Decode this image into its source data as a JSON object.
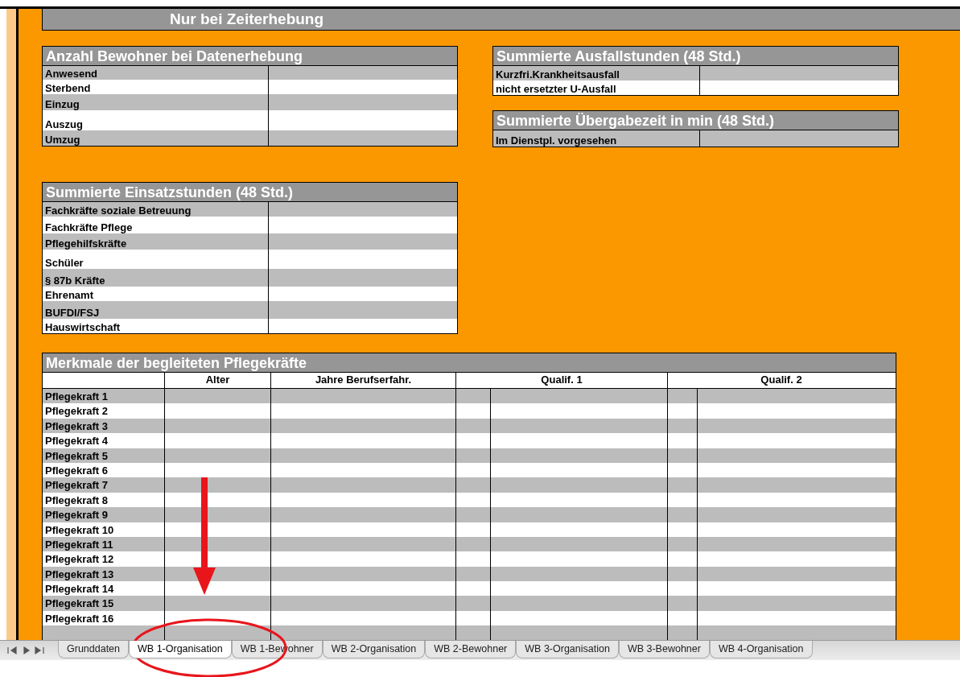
{
  "title": "Nur bei Zeiterhebung",
  "residents": {
    "title": "Anzahl Bewohner bei Datenerhebung",
    "rows": [
      "Anwesend",
      "Sterbend",
      "Einzug",
      "Auszug",
      "Umzug"
    ]
  },
  "absence_hours": {
    "title": "Summierte Ausfallstunden (48 Std.)",
    "rows": [
      "Kurzfri.Krankheitsausfall",
      "nicht ersetzter U-Ausfall"
    ]
  },
  "handover_time": {
    "title": "Summierte Übergabezeit in min (48 Std.)",
    "rows": [
      "Im Dienstpl. vorgesehen"
    ]
  },
  "deployment_hours": {
    "title": "Summierte Einsatzstunden (48 Std.)",
    "rows": [
      "Fachkräfte soziale Betreuung",
      "Fachkräfte Pflege",
      "Pflegehilfskräfte",
      "Schüler",
      "§ 87b Kräfte",
      "Ehrenamt",
      "BUFDI/FSJ",
      "Hauswirtschaft"
    ]
  },
  "staff_table": {
    "title": "Merkmale der begleiteten Pflegekräfte",
    "columns": [
      "Alter",
      "Jahre Berufserfahr.",
      "Qualif. 1",
      "Qualif. 2"
    ],
    "rows": [
      "Pflegekraft 1",
      "Pflegekraft 2",
      "Pflegekraft 3",
      "Pflegekraft 4",
      "Pflegekraft 5",
      "Pflegekraft 6",
      "Pflegekraft 7",
      "Pflegekraft 8",
      "Pflegekraft 9",
      "Pflegekraft 10",
      "Pflegekraft 11",
      "Pflegekraft 12",
      "Pflegekraft 13",
      "Pflegekraft 14",
      "Pflegekraft 15",
      "Pflegekraft 16"
    ]
  },
  "sheet_tabs": [
    {
      "label": "Grunddaten",
      "selected": false
    },
    {
      "label": "WB 1-Organisation",
      "selected": true
    },
    {
      "label": "WB 1-Bewohner",
      "selected": false
    },
    {
      "label": "WB 2-Organisation",
      "selected": false
    },
    {
      "label": "WB 2-Bewohner",
      "selected": false
    },
    {
      "label": "WB 3-Organisation",
      "selected": false
    },
    {
      "label": "WB 3-Bewohner",
      "selected": false
    },
    {
      "label": "WB 4-Organisation",
      "selected": false
    }
  ]
}
